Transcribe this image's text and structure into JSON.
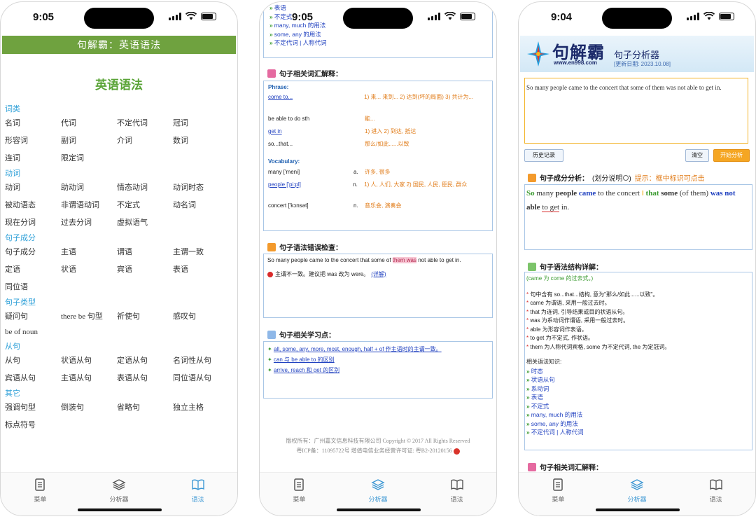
{
  "status": {
    "p1_time": "9:05",
    "p2_time": "9:05",
    "p3_time": "9:04"
  },
  "tabs": {
    "menu": "菜单",
    "analyzer": "分析器",
    "grammar": "语法"
  },
  "p1": {
    "header": "句解霸：英语语法",
    "title": "英语语法",
    "categories": [
      {
        "heading": "词类",
        "items": [
          "名词",
          "代词",
          "不定代词",
          "冠词",
          "形容词",
          "副词",
          "介词",
          "数词",
          "连词",
          "限定词"
        ]
      },
      {
        "heading": "动词",
        "items": [
          "动词",
          "助动词",
          "情态动词",
          "动词时态",
          "被动语态",
          "非谓语动词",
          "不定式",
          "动名词",
          "现在分词",
          "过去分词",
          "虚拟语气"
        ]
      },
      {
        "heading": "句子成分",
        "items": [
          "句子成分",
          "主语",
          "谓语",
          "主谓一致",
          "定语",
          "状语",
          "宾语",
          "表语",
          "同位语"
        ]
      },
      {
        "heading": "句子类型",
        "items": [
          "疑问句",
          "there be 句型",
          "祈使句",
          "感叹句",
          "be of noun"
        ]
      },
      {
        "heading": "从句",
        "items": [
          "从句",
          "状语从句",
          "定语从句",
          "名词性从句",
          "宾语从句",
          "主语从句",
          "表语从句",
          "同位语从句"
        ]
      },
      {
        "heading": "其它",
        "items": [
          "强调句型",
          "倒装句",
          "省略句",
          "独立主格",
          "标点符号"
        ]
      }
    ]
  },
  "p2": {
    "top_list": [
      "表语",
      "不定式",
      "many, much 的用法",
      "some, any 的用法",
      "不定代词 | 人称代词"
    ],
    "vocab_heading": "句子相关词汇解释：",
    "phrase_label": "Phrase:",
    "phrases": [
      {
        "term": "come to...",
        "meaning": "1) 来... 来到... 2) 达到(坏的局面) 3) 共计为...",
        "link": true
      },
      {
        "term": "be able to do sth",
        "meaning": "能...",
        "link": false
      },
      {
        "term": "get in",
        "meaning": "1) 进入 2) 到达, 抵达",
        "link": true
      },
      {
        "term": "so...that...",
        "meaning": "那么/如此......以致",
        "link": false
      }
    ],
    "vocabulary_label": "Vocabulary:",
    "vocabulary": [
      {
        "term": "many ['meni]",
        "pos": "a.",
        "meaning": "许多, 很多",
        "link": false
      },
      {
        "term": "people ['pi:pl]",
        "pos": "n.",
        "meaning": "1) 人, 人们, 大家 2) 国民, 人民, 臣民, 群众",
        "link": true
      },
      {
        "term": "concert ['kɔnsət]",
        "pos": "n.",
        "meaning": "音乐会, 演奏会",
        "link": false
      }
    ],
    "error_heading": "句子语法错误检查：",
    "error_sentence_pre": "So many people came to the concert that some of ",
    "error_sentence_hl": "them was",
    "error_sentence_post": " not able to get in.",
    "error_msg": "主谓不一致。建议把 was 改为 were。",
    "error_detail": "(详解)",
    "points_heading": "句子相关学习点：",
    "points": [
      "all, some, any, more, most, enough, half + of 作主语时的主谓一致。",
      "can 与 be able to 的区别",
      "arrive, reach 和 get 的区别"
    ],
    "footer1": "版权所有：广州嘉文信息科技有限公司 Copyright © 2017 All Rights Reserved",
    "footer2": "粤ICP备：11095722号    增值电信业务经营许可证: 粤B2-20120156"
  },
  "p3": {
    "logo": "句解霸",
    "logo_url": "www.en998.com",
    "subtitle": "句子分析器",
    "update": "[更新日期: 2023.10.08]",
    "input_text": "So many people came to the concert that some of them was not able to get in.",
    "history_btn": "历史记录",
    "clear_btn": "清空",
    "analyze_btn": "开始分析",
    "comp_heading": "句子成分分析：",
    "comp_note": "(划分说明",
    "comp_tip": "提示：框中标识可点击",
    "struct_heading": "句子语法结构详解：",
    "struct_note": "(came 为 come 的过去式。)",
    "struct_points": [
      "句中含有 so...that...结构, 意为\"那么/如此......以致\"。",
      "came 为谓语, 采用一般过去时。",
      "that 为连词, 引导结果或目的状语从句。",
      "was 为系动词作谓语, 采用一般过去时。",
      "able 为形容词作表语。",
      "to get 为不定式, 作状语。",
      "them 为人称代词宾格, some 为不定代词, the 为定冠词。"
    ],
    "related_label": "相关语法知识:",
    "related": [
      "时态",
      "状语从句",
      "系动词",
      "表语",
      "不定式",
      "many, much 的用法",
      "some, any 的用法",
      "不定代词 | 人称代词"
    ],
    "vocab_heading": "句子相关词汇解释："
  },
  "colors": {
    "green_header": "#6fa23f",
    "accent_blue": "#3d98d4",
    "link_blue": "#1e3fbf",
    "orange": "#e07a16"
  }
}
